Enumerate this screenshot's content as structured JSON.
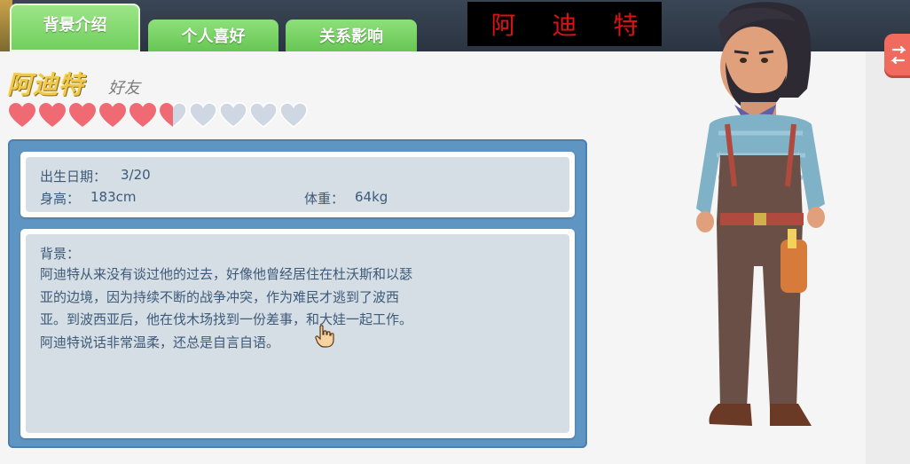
{
  "tabs": [
    {
      "label": "背景介绍",
      "active": true
    },
    {
      "label": "个人喜好",
      "active": false
    },
    {
      "label": "关系影响",
      "active": false
    }
  ],
  "name_banner": {
    "chars": [
      "阿",
      "迪",
      "特"
    ]
  },
  "character": {
    "name": "阿迪特",
    "relation": "好友",
    "hearts_total": 10,
    "hearts_filled": 5.5
  },
  "stats": {
    "birthday_label": "出生日期：",
    "birthday_value": "3/20",
    "height_label": "身高：",
    "height_value": "183cm",
    "weight_label": "体重：",
    "weight_value": "64kg"
  },
  "background": {
    "label": "背景：",
    "text": "阿迪特从来没有谈过他的过去，好像他曾经居住在杜沃斯和以瑟亚的边境，因为持续不断的战争冲突，作为难民才逃到了波西亚。到波西亚后，他在伐木场找到一份差事，和大娃一起工作。阿迪特说话非常温柔，还总是自言自语。"
  },
  "colors": {
    "tab_green": "#6fcf5b",
    "heart_filled": "#f06a74",
    "heart_empty": "#cfd8e2",
    "frame_blue": "#5f95c2",
    "text_blue": "#3d5a78",
    "name_gold": "#f0c94a",
    "banner_text": "#e01010"
  },
  "icons": {
    "side_button": "arrow-swap-icon",
    "cursor": "hand-cursor-icon"
  }
}
